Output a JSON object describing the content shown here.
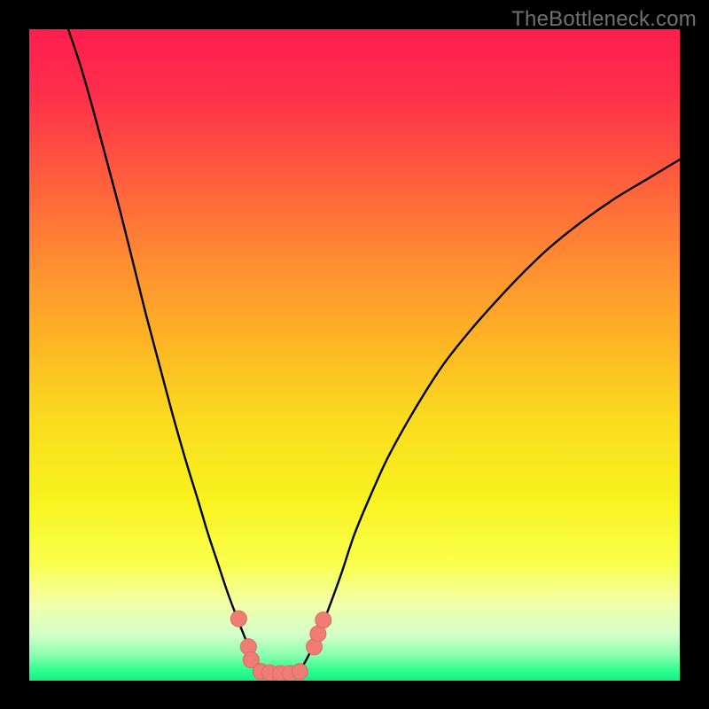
{
  "watermark": "TheBottleneck.com",
  "colors": {
    "dot_fill": "#ED7D75",
    "dot_stroke": "#E2665F",
    "curve": "#000000",
    "frame": "#000000"
  },
  "gradient_stops": [
    {
      "offset": 0.0,
      "color": "#FF1E4E"
    },
    {
      "offset": 0.1,
      "color": "#FF2F4B"
    },
    {
      "offset": 0.22,
      "color": "#FF5A3E"
    },
    {
      "offset": 0.35,
      "color": "#FF8A32"
    },
    {
      "offset": 0.48,
      "color": "#FDB524"
    },
    {
      "offset": 0.6,
      "color": "#FADB1F"
    },
    {
      "offset": 0.72,
      "color": "#F8F21E"
    },
    {
      "offset": 0.82,
      "color": "#F9FF4C"
    },
    {
      "offset": 0.88,
      "color": "#F4FFA7"
    },
    {
      "offset": 0.93,
      "color": "#D2FFC9"
    },
    {
      "offset": 0.96,
      "color": "#8CFFB0"
    },
    {
      "offset": 0.985,
      "color": "#2CFF8D"
    },
    {
      "offset": 1.0,
      "color": "#13F184"
    }
  ],
  "chart_data": {
    "type": "line",
    "title": "",
    "xlabel": "",
    "ylabel": "",
    "xlim": [
      0,
      100
    ],
    "ylim": [
      0,
      100
    ],
    "series": [
      {
        "name": "bottleneck-curve",
        "x": [
          6.0,
          8.0,
          10.0,
          12.0,
          14.0,
          16.0,
          18.0,
          20.0,
          22.0,
          24.0,
          26.0,
          27.5,
          29.0,
          30.5,
          32.0,
          33.2,
          34.2,
          35.2,
          36.2,
          37.4,
          38.8,
          40.0,
          41.0,
          42.0,
          43.0,
          44.4,
          46.0,
          48.0,
          50.0,
          52.5,
          55.0,
          58.0,
          61.0,
          64.0,
          68.0,
          72.0,
          76.0,
          80.0,
          85.0,
          90.0,
          95.0,
          100.0
        ],
        "values": [
          100.0,
          94.0,
          87.0,
          79.5,
          72.0,
          64.0,
          56.0,
          48.5,
          41.0,
          34.0,
          27.5,
          22.5,
          18.0,
          13.5,
          9.5,
          6.5,
          4.2,
          2.6,
          1.6,
          1.1,
          1.0,
          1.05,
          1.3,
          2.2,
          4.0,
          7.0,
          11.0,
          16.5,
          22.5,
          28.5,
          34.0,
          39.5,
          44.5,
          49.0,
          54.0,
          58.5,
          62.7,
          66.5,
          70.5,
          74.0,
          77.0,
          80.0
        ]
      }
    ],
    "dots": [
      {
        "x": 32.2,
        "y": 9.5
      },
      {
        "x": 33.7,
        "y": 5.2
      },
      {
        "x": 34.1,
        "y": 3.2
      },
      {
        "x": 35.6,
        "y": 1.4
      },
      {
        "x": 37.0,
        "y": 1.2
      },
      {
        "x": 38.6,
        "y": 1.1
      },
      {
        "x": 40.1,
        "y": 1.1
      },
      {
        "x": 41.6,
        "y": 1.4
      },
      {
        "x": 43.8,
        "y": 5.2
      },
      {
        "x": 44.4,
        "y": 7.2
      },
      {
        "x": 45.2,
        "y": 9.3
      }
    ]
  }
}
